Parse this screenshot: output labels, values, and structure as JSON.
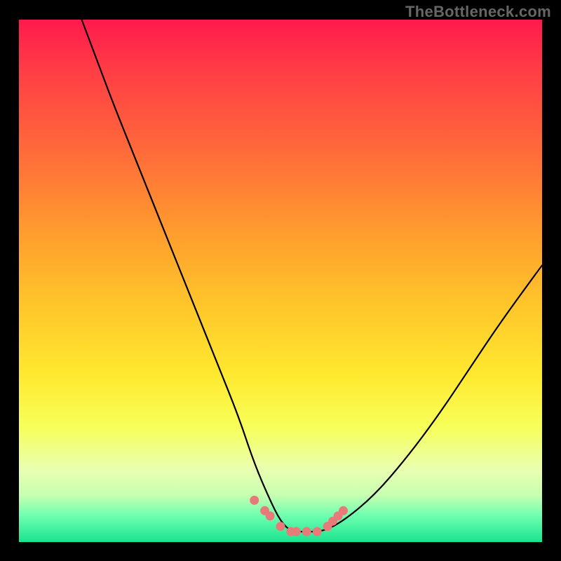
{
  "watermark": {
    "text": "TheBottleneck.com"
  },
  "chart_data": {
    "type": "line",
    "title": "",
    "xlabel": "",
    "ylabel": "",
    "xlim": [
      0,
      100
    ],
    "ylim": [
      0,
      100
    ],
    "series": [
      {
        "name": "curve",
        "x": [
          12,
          15,
          18,
          22,
          26,
          30,
          34,
          38,
          42,
          45,
          48,
          50,
          52,
          55,
          58,
          62,
          68,
          74,
          80,
          86,
          92,
          100
        ],
        "y": [
          100,
          92,
          84,
          74,
          64,
          54,
          44,
          34,
          24,
          15,
          8,
          4,
          2,
          2,
          2,
          4,
          9,
          16,
          24,
          33,
          42,
          53
        ]
      }
    ],
    "markers": {
      "name": "highlight-points",
      "color": "#e97a7a",
      "x": [
        45,
        47,
        48,
        50,
        52,
        53,
        55,
        57,
        59,
        60,
        61,
        62
      ],
      "y": [
        8,
        6,
        5,
        3,
        2,
        2,
        2,
        2,
        3,
        4,
        5,
        6
      ]
    },
    "background_gradient": {
      "top": "#ff1a4d",
      "upper_mid": "#ff9a2e",
      "mid": "#ffe92f",
      "lower_mid": "#eaffb0",
      "bottom": "#19e38e"
    }
  }
}
